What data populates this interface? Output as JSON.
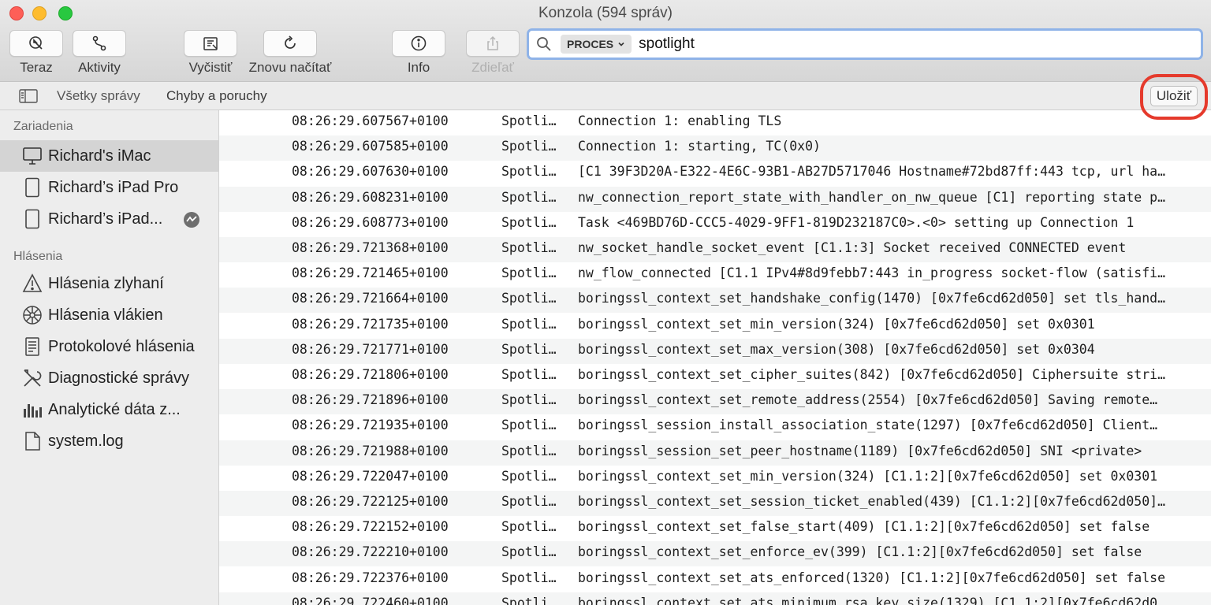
{
  "window": {
    "title": "Konzola (594 správ)"
  },
  "toolbar": {
    "now": "Teraz",
    "activities": "Aktivity",
    "clear": "Vyčistiť",
    "reload": "Znovu načítať",
    "info": "Info",
    "share": "Zdieľať"
  },
  "search": {
    "token": "PROCES",
    "query": "spotlight"
  },
  "filters": {
    "all": "Všetky správy",
    "errors": "Chyby a poruchy",
    "save": "Uložiť"
  },
  "sidebar": {
    "devices_title": "Zariadenia",
    "devices": [
      "Richard's iMac",
      "Richard’s iPad Pro",
      "Richard’s iPad..."
    ],
    "reports_title": "Hlásenia",
    "reports": [
      "Hlásenia zlyhaní",
      "Hlásenia vlákien",
      "Protokolové hlásenia",
      "Diagnostické správy",
      "Analytické dáta z...",
      "system.log"
    ]
  },
  "log": {
    "rows": [
      {
        "time": "08:26:29.607567+0100",
        "process": "Spotli…",
        "message": "Connection 1: enabling TLS"
      },
      {
        "time": "08:26:29.607585+0100",
        "process": "Spotli…",
        "message": "Connection 1: starting, TC(0x0)"
      },
      {
        "time": "08:26:29.607630+0100",
        "process": "Spotli…",
        "message": "[C1 39F3D20A-E322-4E6C-93B1-AB27D5717046 Hostname#72bd87ff:443 tcp, url ha…"
      },
      {
        "time": "08:26:29.608231+0100",
        "process": "Spotli…",
        "message": "nw_connection_report_state_with_handler_on_nw_queue [C1] reporting state p…"
      },
      {
        "time": "08:26:29.608773+0100",
        "process": "Spotli…",
        "message": "Task <469BD76D-CCC5-4029-9FF1-819D232187C0>.<0> setting up Connection 1"
      },
      {
        "time": "08:26:29.721368+0100",
        "process": "Spotli…",
        "message": "nw_socket_handle_socket_event [C1.1:3] Socket received CONNECTED event"
      },
      {
        "time": "08:26:29.721465+0100",
        "process": "Spotli…",
        "message": "nw_flow_connected [C1.1 IPv4#8d9febb7:443 in_progress socket-flow (satisfi…"
      },
      {
        "time": "08:26:29.721664+0100",
        "process": "Spotli…",
        "message": "boringssl_context_set_handshake_config(1470) [0x7fe6cd62d050] set tls_hand…"
      },
      {
        "time": "08:26:29.721735+0100",
        "process": "Spotli…",
        "message": "boringssl_context_set_min_version(324) [0x7fe6cd62d050] set 0x0301"
      },
      {
        "time": "08:26:29.721771+0100",
        "process": "Spotli…",
        "message": "boringssl_context_set_max_version(308) [0x7fe6cd62d050] set 0x0304"
      },
      {
        "time": "08:26:29.721806+0100",
        "process": "Spotli…",
        "message": "boringssl_context_set_cipher_suites(842) [0x7fe6cd62d050] Ciphersuite stri…"
      },
      {
        "time": "08:26:29.721896+0100",
        "process": "Spotli…",
        "message": "boringssl_context_set_remote_address(2554) [0x7fe6cd62d050] Saving remote…"
      },
      {
        "time": "08:26:29.721935+0100",
        "process": "Spotli…",
        "message": "boringssl_session_install_association_state(1297) [0x7fe6cd62d050] Client…"
      },
      {
        "time": "08:26:29.721988+0100",
        "process": "Spotli…",
        "message": "boringssl_session_set_peer_hostname(1189) [0x7fe6cd62d050] SNI <private>"
      },
      {
        "time": "08:26:29.722047+0100",
        "process": "Spotli…",
        "message": "boringssl_context_set_min_version(324) [C1.1:2][0x7fe6cd62d050] set 0x0301"
      },
      {
        "time": "08:26:29.722125+0100",
        "process": "Spotli…",
        "message": "boringssl_context_set_session_ticket_enabled(439) [C1.1:2][0x7fe6cd62d050]…"
      },
      {
        "time": "08:26:29.722152+0100",
        "process": "Spotli…",
        "message": "boringssl_context_set_false_start(409) [C1.1:2][0x7fe6cd62d050] set false"
      },
      {
        "time": "08:26:29.722210+0100",
        "process": "Spotli…",
        "message": "boringssl_context_set_enforce_ev(399) [C1.1:2][0x7fe6cd62d050] set false"
      },
      {
        "time": "08:26:29.722376+0100",
        "process": "Spotli…",
        "message": "boringssl_context_set_ats_enforced(1320) [C1.1:2][0x7fe6cd62d050] set false"
      },
      {
        "time": "08:26:29.722460+0100",
        "process": "Spotli…",
        "message": "boringssl_context_set_ats_minimum_rsa_key_size(1329) [C1.1:2][0x7fe6cd62d0…"
      }
    ]
  },
  "colors": {
    "accent_ring": "#8fb3e8",
    "highlight": "#e53a2c",
    "selected_row": "#d4d4d4"
  },
  "icons": [
    "now-icon",
    "activities-icon",
    "clear-icon",
    "reload-icon",
    "info-icon",
    "share-icon",
    "search-icon",
    "sidebar-toggle-icon",
    "imac-icon",
    "ipad-icon",
    "activity-badge-icon",
    "warning-icon",
    "spindump-icon",
    "log-report-icon",
    "tools-icon",
    "analytics-icon",
    "file-icon"
  ]
}
